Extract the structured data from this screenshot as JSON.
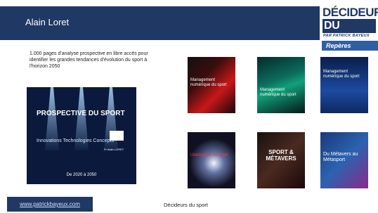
{
  "header": {
    "name": "Alain Loret"
  },
  "logo": {
    "line1": "DÉCIDEURS",
    "line2": "DU SPORT",
    "line3": "PAR PATRICK BAYEUX",
    "line4": "Repères"
  },
  "intro": "1.000 pages d'analyse prospective en libre accès pour identifier les grandes tendances d'évolution du sport à l'horizon 2050",
  "main_cover": {
    "title": "PROSPECTIVE DU SPORT",
    "subtitle": "Innovations Technologies Concepts",
    "author": "Pr Alain LORET",
    "dates": "De 2020 à 2050"
  },
  "covers": [
    {
      "title": "Management numérique du sport"
    },
    {
      "title": "Management numérique du sport"
    },
    {
      "title": "Management numérique du sport"
    },
    {
      "title": "Ubérisation du sport"
    },
    {
      "title": "SPORT & MÉTAVERS"
    },
    {
      "title": "Du Métavers au Métasport"
    }
  ],
  "url": "www.patrickbayeux.com",
  "footer": "Décideurs du sport"
}
